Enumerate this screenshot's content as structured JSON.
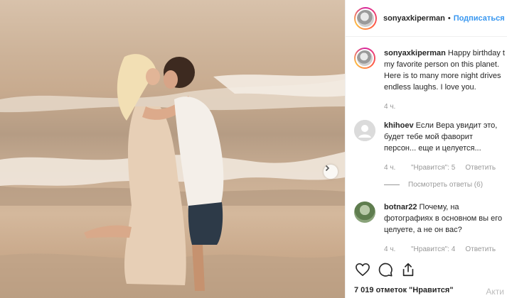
{
  "post": {
    "username": "sonyaxkiperman",
    "separator": "•",
    "follow_label": "Подписаться",
    "photo_alt": "",
    "likes_text": "7 019 отметок \"Нравится\""
  },
  "caption": {
    "username": "sonyaxkiperman",
    "text": "Happy birthday t",
    "lines": [
      "my favorite person on this planet.",
      "Here is to many more night drives",
      "endless laughs. I love you."
    ],
    "time": "4 ч."
  },
  "comments": [
    {
      "username": "khihoev",
      "line1": "Если Вера увидит это,",
      "lines": [
        "будет тебе мой фаворит",
        "персон... еще и целуется..."
      ],
      "time": "4 ч.",
      "likes": "\"Нравится\": 5",
      "reply": "Ответить",
      "view_replies": "Посмотреть ответы (6)"
    },
    {
      "username": "botnar22",
      "line1": "Почему, на",
      "lines": [
        "фотографиях в основном вы его",
        "целуете, а не он вас?"
      ],
      "time": "4 ч.",
      "likes": "\"Нравится\": 4",
      "reply": "Ответить"
    }
  ],
  "icons": [
    "heart-icon",
    "comment-icon",
    "share-icon",
    "chevron-right-icon"
  ],
  "watermark": "Акти",
  "colors": {
    "link": "#3897f0",
    "muted": "#999999",
    "text": "#262626"
  }
}
